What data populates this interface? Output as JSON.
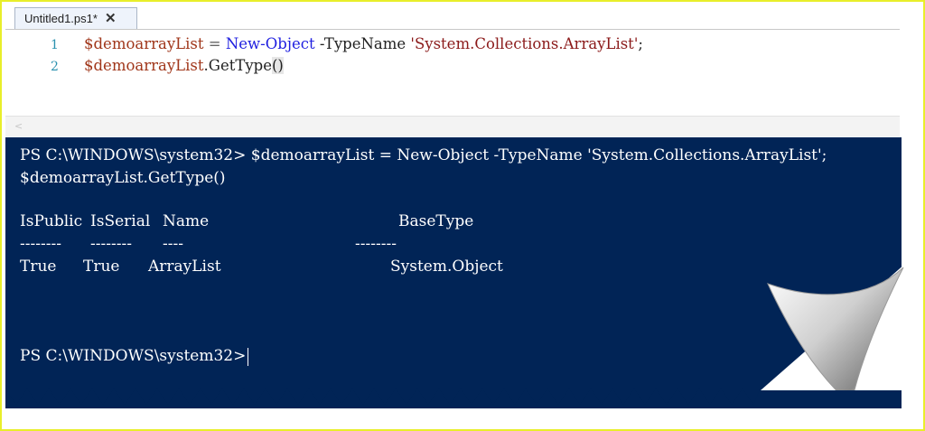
{
  "tab": {
    "label": "Untitled1.ps1*",
    "close_glyph": "✕"
  },
  "editor": {
    "lines": [
      {
        "number": "1",
        "var": "$demoarrayList",
        "op": " = ",
        "cmd": "New-Object",
        "param": " -TypeName ",
        "str": "'System.Collections.ArrayList'",
        "end": ";"
      },
      {
        "number": "2",
        "var": "$demoarrayList",
        "method": ".GetType",
        "paren": "()"
      }
    ]
  },
  "scrollbar": {
    "left_arrow": "<"
  },
  "console": {
    "line1": "PS C:\\WINDOWS\\system32> $demoarrayList = New-Object -TypeName 'System.Collections.ArrayList';",
    "line2": "$demoarrayList.GetType()",
    "header": {
      "c1": "IsPublic",
      "c2": "IsSerial",
      "c3": "Name",
      "c4": "BaseType"
    },
    "sep": {
      "c1": "--------",
      "c2": "--------",
      "c3": "----",
      "c4": "--------"
    },
    "row": {
      "c1": "True",
      "c2": "True",
      "c3": "ArrayList",
      "c4": "System.Object"
    },
    "prompt": "PS C:\\WINDOWS\\system32>"
  },
  "colors": {
    "console_bg": "#012456",
    "frame_border": "#e8ee2a"
  }
}
